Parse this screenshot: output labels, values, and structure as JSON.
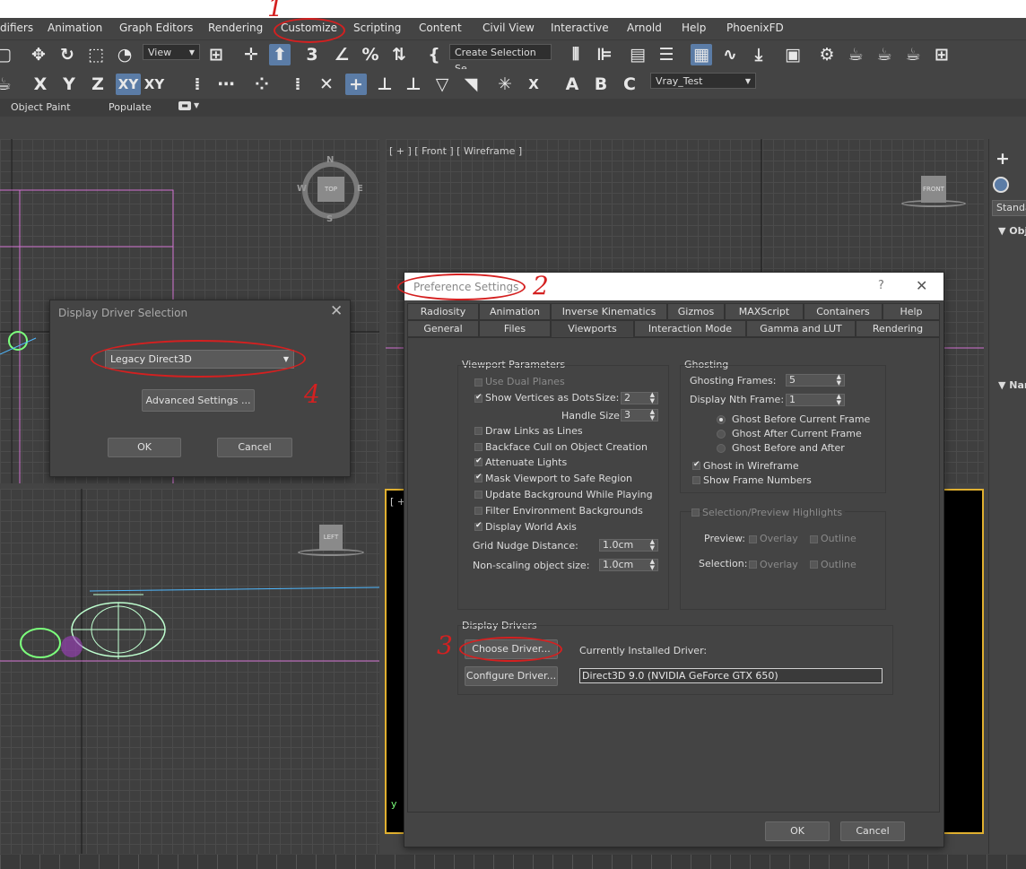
{
  "menu": {
    "items": [
      "difiers",
      "Animation",
      "Graph Editors",
      "Rendering",
      "Customize",
      "Scripting",
      "Content",
      "Civil View",
      "Interactive",
      "Arnold",
      "Help",
      "PhoenixFD"
    ]
  },
  "toolbar": {
    "view_dropdown": "View",
    "selection_set_dropdown": "Create Selection Se",
    "axis_x": "X",
    "axis_y": "Y",
    "axis_z": "Z",
    "axis_xy": "XY",
    "axis_xy2": "XY",
    "vray_dropdown": "Vray_Test"
  },
  "ribbon": {
    "object_paint": "Object Paint",
    "populate": "Populate"
  },
  "viewports": {
    "front_label": "[ + ] [ Front ] [ Wireframe ]",
    "bottom_right_label": "[ +",
    "top_nav_n": "N",
    "top_nav_s": "S",
    "top_nav_w": "W",
    "top_nav_e": "E",
    "top_cube": "TOP",
    "front_cube": "FRONT",
    "left_cube": "LEFT",
    "axis_y_small": "y"
  },
  "right_panel": {
    "standard": "Standa",
    "object_type": "Obj",
    "name_color": "Nar"
  },
  "display_driver_dialog": {
    "title": "Display Driver Selection",
    "driver": "Legacy Direct3D",
    "advanced_button": "Advanced Settings ...",
    "ok": "OK",
    "cancel": "Cancel"
  },
  "preferences": {
    "title": "Preference Settings",
    "help_icon": "?",
    "tabs_row1": [
      "Radiosity",
      "Animation",
      "Inverse Kinematics",
      "Gizmos",
      "MAXScript",
      "Containers",
      "Help"
    ],
    "tabs_row2": [
      "General",
      "Files",
      "Viewports",
      "Interaction Mode",
      "Gamma and LUT",
      "Rendering"
    ],
    "active_tab": "Viewports",
    "viewport_params": {
      "title": "Viewport Parameters",
      "use_dual_planes": "Use Dual Planes",
      "show_vertices": "Show Vertices as Dots",
      "size_label": "Size:",
      "size_value": "2",
      "handle_size_label": "Handle Size:",
      "handle_size_value": "3",
      "draw_links": "Draw Links as Lines",
      "backface_cull": "Backface Cull on Object Creation",
      "attenuate_lights": "Attenuate Lights",
      "mask_viewport": "Mask Viewport to Safe Region",
      "update_background": "Update Background While Playing",
      "filter_env": "Filter Environment Backgrounds",
      "display_world_axis": "Display World Axis",
      "grid_nudge_label": "Grid Nudge Distance:",
      "grid_nudge_value": "1.0cm",
      "non_scaling_label": "Non-scaling object size:",
      "non_scaling_value": "1.0cm"
    },
    "ghosting": {
      "title": "Ghosting",
      "frames_label": "Ghosting Frames:",
      "frames_value": "5",
      "nth_label": "Display Nth Frame:",
      "nth_value": "1",
      "before": "Ghost Before Current Frame",
      "after": "Ghost After Current Frame",
      "before_after": "Ghost Before and After",
      "in_wireframe": "Ghost in Wireframe",
      "show_numbers": "Show Frame Numbers"
    },
    "highlights": {
      "title": "Selection/Preview Highlights",
      "preview_label": "Preview:",
      "selection_label": "Selection:",
      "overlay": "Overlay",
      "outline": "Outline"
    },
    "display_drivers": {
      "title": "Display Drivers",
      "choose_button": "Choose Driver...",
      "configure_button": "Configure Driver...",
      "installed_label": "Currently Installed Driver:",
      "installed_value": "Direct3D 9.0 (NVIDIA GeForce GTX 650)"
    },
    "ok": "OK",
    "cancel": "Cancel"
  },
  "annotations": {
    "n1": "1",
    "n2": "2",
    "n3": "3",
    "n4": "4"
  },
  "colors": {
    "annotation_red": "#d42020",
    "active_blue": "#5b7ca6",
    "wire_pink": "#d070d0",
    "wire_green": "#7cff7c",
    "wire_cyan": "#4fb8ff"
  }
}
